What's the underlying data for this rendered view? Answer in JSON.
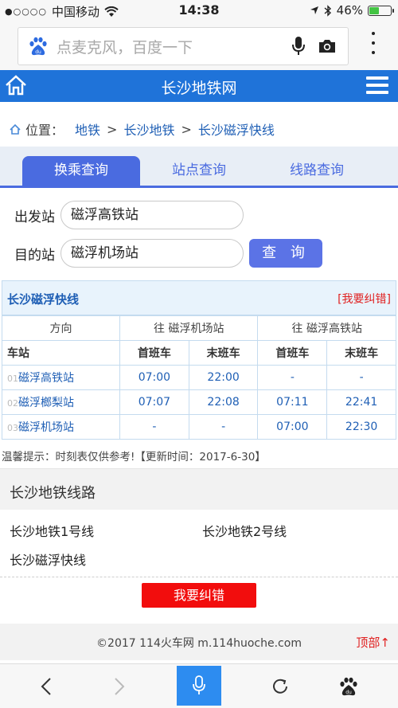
{
  "status": {
    "carrier": "中国移动",
    "time": "14:38",
    "battery": "46%",
    "battery_level": 0.46,
    "battery_color": "#43c443"
  },
  "browser": {
    "search_placeholder": "点麦克风，百度一下"
  },
  "header": {
    "title": "长沙地铁网",
    "bg_color": "#1f73d9"
  },
  "breadcrumb": {
    "label": "位置：",
    "items": [
      "地铁",
      "长沙地铁",
      "长沙磁浮快线"
    ],
    "sep": ">"
  },
  "tabs": [
    {
      "label": "换乘查询",
      "active": true
    },
    {
      "label": "站点查询",
      "active": false
    },
    {
      "label": "线路查询",
      "active": false
    }
  ],
  "form": {
    "from_label": "出发站",
    "from_value": "磁浮高铁站",
    "to_label": "目的站",
    "to_value": "磁浮机场站",
    "query_label": "查 询"
  },
  "timetable": {
    "title": "长沙磁浮快线",
    "report_link": "[我要纠错]",
    "direction_label": "方向",
    "dir1": "往 磁浮机场站",
    "dir2": "往 磁浮高铁站",
    "station_label": "车站",
    "first_label": "首班车",
    "last_label": "末班车",
    "rows": [
      {
        "idx": "01",
        "station": "磁浮高铁站",
        "d1_first": "07:00",
        "d1_last": "22:00",
        "d2_first": "-",
        "d2_last": "-"
      },
      {
        "idx": "02",
        "station": "磁浮榔梨站",
        "d1_first": "07:07",
        "d1_last": "22:08",
        "d2_first": "07:11",
        "d2_last": "22:41"
      },
      {
        "idx": "03",
        "station": "磁浮机场站",
        "d1_first": "-",
        "d1_last": "-",
        "d2_first": "07:00",
        "d2_last": "22:30"
      }
    ]
  },
  "tip": "温馨提示：时刻表仅供参考!【更新时间：2017-6-30】",
  "lines": {
    "title": "长沙地铁线路",
    "items": [
      "长沙地铁1号线",
      "长沙地铁2号线",
      "长沙磁浮快线"
    ]
  },
  "report_button": "我要纠错",
  "footer": {
    "copyright": "©2017 114火车网 m.114huoche.com",
    "to_top": "顶部↑"
  },
  "toolbar": {
    "icons": [
      "back-icon",
      "forward-icon",
      "microphone-icon",
      "refresh-icon",
      "baidu-paw-icon"
    ],
    "voice_color": "#2d8cf0"
  }
}
